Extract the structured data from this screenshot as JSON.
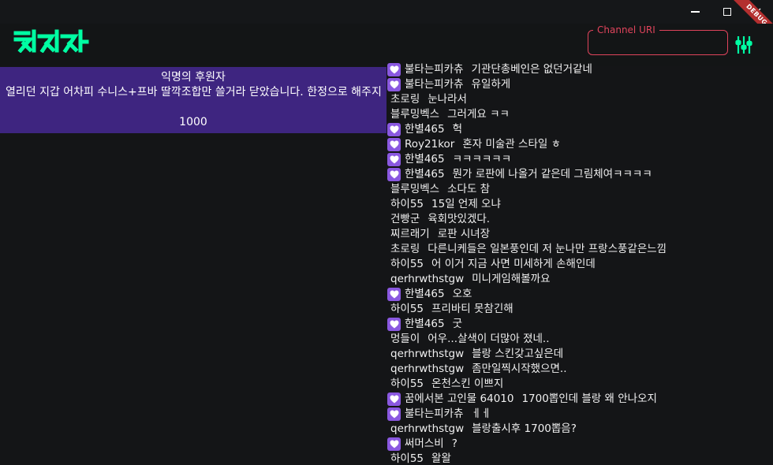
{
  "window": {
    "minimize_icon": "minimize-icon",
    "maximize_icon": "maximize-icon",
    "close_icon": "close-icon",
    "debug_banner": "DEBUG"
  },
  "app": {
    "logo": "치지직",
    "brand_color": "#00ffa3"
  },
  "channel_uri": {
    "label": "Channel URI",
    "value": "",
    "accent": "#e0445c"
  },
  "donation": {
    "name": "익명의 후원자",
    "message": "열리던 지갑 어차피 수니스+프바 딸깍조합만 쓸거라 닫았습니다. 한정으로 해주지",
    "amount": "1000",
    "bg_color": "#3e2580"
  },
  "chat": {
    "badge_color": "#8a58e0",
    "messages": [
      {
        "nick": "불타는피카츄",
        "text": "기관단총베인은 없던거같네",
        "sub": true
      },
      {
        "nick": "불타는피카츄",
        "text": "유일하게",
        "sub": true
      },
      {
        "nick": "초로링",
        "text": "눈나라서",
        "sub": false
      },
      {
        "nick": "블루밍벡스",
        "text": "그러게요 ㅋㅋ",
        "sub": false
      },
      {
        "nick": "한별465",
        "text": "헉",
        "sub": true
      },
      {
        "nick": "Roy21kor",
        "text": "혼자 미술관 스타일 ㅎ",
        "sub": true
      },
      {
        "nick": "한별465",
        "text": "ㅋㅋㅋㅋㅋㅋ",
        "sub": true
      },
      {
        "nick": "한별465",
        "text": "뭔가 로판에 나올거 같은데 그림체여ㅋㅋㅋㅋ",
        "sub": true
      },
      {
        "nick": "블루밍벡스",
        "text": "소다도 참",
        "sub": false
      },
      {
        "nick": "하이55",
        "text": "15일 언제 오냐",
        "sub": false
      },
      {
        "nick": "건빵군",
        "text": "육회맛있겠다.",
        "sub": false
      },
      {
        "nick": "찌르래기",
        "text": "로판 시녀장",
        "sub": false
      },
      {
        "nick": "초로링",
        "text": "다른니케들은 일본풍인데 저 눈나만 프랑스풍같은느낌",
        "sub": false
      },
      {
        "nick": "하이55",
        "text": "어 이거 지금 사면 미세하게 손해인데",
        "sub": false
      },
      {
        "nick": "qerhrwthstgw",
        "text": "미니게임해볼까요",
        "sub": false
      },
      {
        "nick": "한별465",
        "text": "오호",
        "sub": true
      },
      {
        "nick": "하이55",
        "text": "프리바티 못참긴해",
        "sub": false
      },
      {
        "nick": "한별465",
        "text": "굿",
        "sub": true
      },
      {
        "nick": "멍들이",
        "text": "어우...살색이 더많아 졌네..",
        "sub": false
      },
      {
        "nick": "qerhrwthstgw",
        "text": "블랑 스킨갖고싶은데",
        "sub": false
      },
      {
        "nick": "qerhrwthstgw",
        "text": "좀만일찍시작했으면..",
        "sub": false
      },
      {
        "nick": "하이55",
        "text": "온천스킨 이쁘지",
        "sub": false
      },
      {
        "nick": "꿈에서본 고인물 64010",
        "text": "1700뽑인데 블랑 왜 안나오지",
        "sub": true
      },
      {
        "nick": "불타는피카츄",
        "text": "ㅔㅔ",
        "sub": true
      },
      {
        "nick": "qerhrwthstgw",
        "text": "블랑출시후 1700뽑음?",
        "sub": false
      },
      {
        "nick": "써머스비",
        "text": "?",
        "sub": true
      },
      {
        "nick": "하이55",
        "text": "왈왈",
        "sub": false
      }
    ]
  }
}
